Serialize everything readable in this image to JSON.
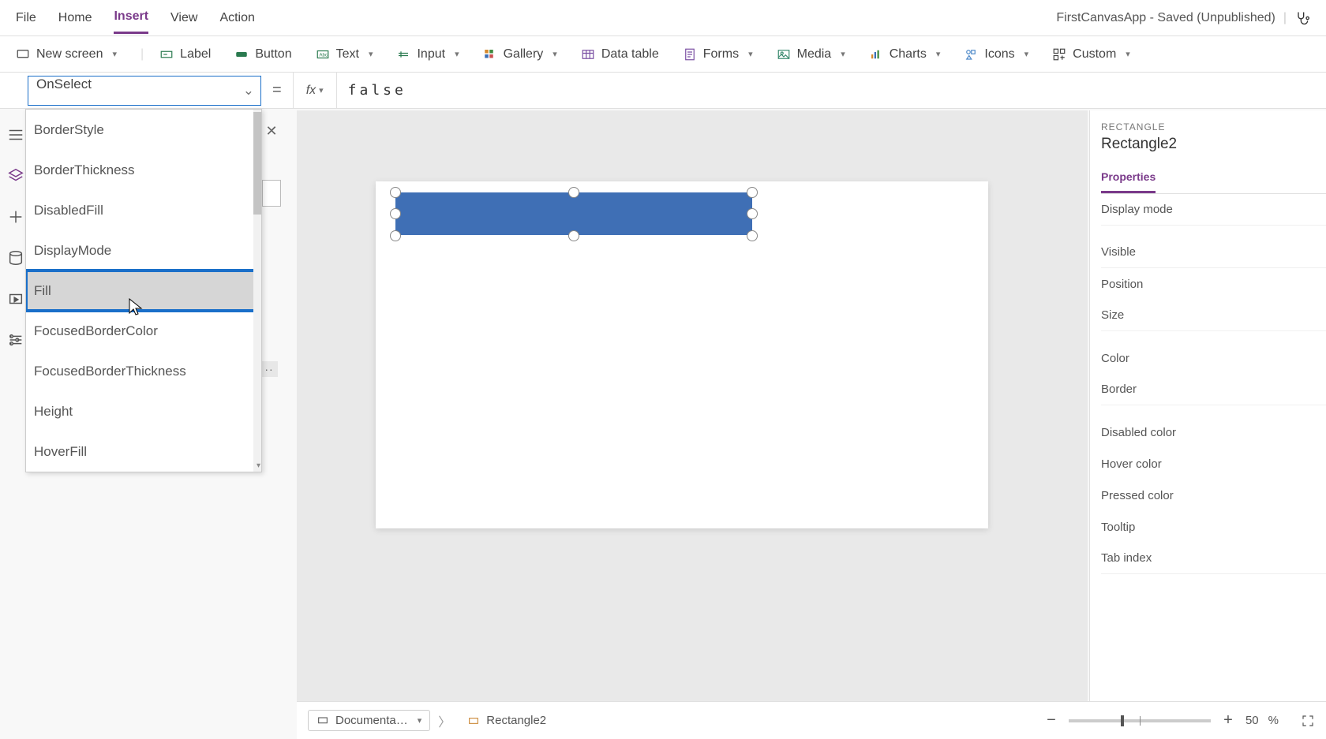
{
  "app_title": "FirstCanvasApp - Saved (Unpublished)",
  "menu": {
    "items": [
      "File",
      "Home",
      "Insert",
      "View",
      "Action"
    ],
    "active_index": 2
  },
  "ribbon": {
    "new_screen": "New screen",
    "label": "Label",
    "button": "Button",
    "text": "Text",
    "input": "Input",
    "gallery": "Gallery",
    "data_table": "Data table",
    "forms": "Forms",
    "media": "Media",
    "charts": "Charts",
    "icons": "Icons",
    "custom": "Custom"
  },
  "formula": {
    "property": "OnSelect",
    "equals": "=",
    "fx": "fx",
    "value": "false"
  },
  "property_dropdown": {
    "items": [
      "BorderStyle",
      "BorderThickness",
      "DisabledFill",
      "DisplayMode",
      "Fill",
      "FocusedBorderColor",
      "FocusedBorderThickness",
      "Height",
      "HoverFill"
    ],
    "highlight_index": 4
  },
  "right_panel": {
    "type_label": "RECTANGLE",
    "name": "Rectangle2",
    "tabs": [
      "Properties"
    ],
    "active_tab": 0,
    "rows": [
      "Display mode",
      "Visible",
      "Position",
      "Size",
      "Color",
      "Border",
      "Disabled color",
      "Hover color",
      "Pressed color",
      "Tooltip",
      "Tab index"
    ]
  },
  "breadcrumb": {
    "screen": "Documenta…",
    "shape": "Rectangle2"
  },
  "zoom": {
    "percent": "50",
    "suffix": "%"
  },
  "canvas": {
    "shape_fill": "#3f6fb5"
  }
}
